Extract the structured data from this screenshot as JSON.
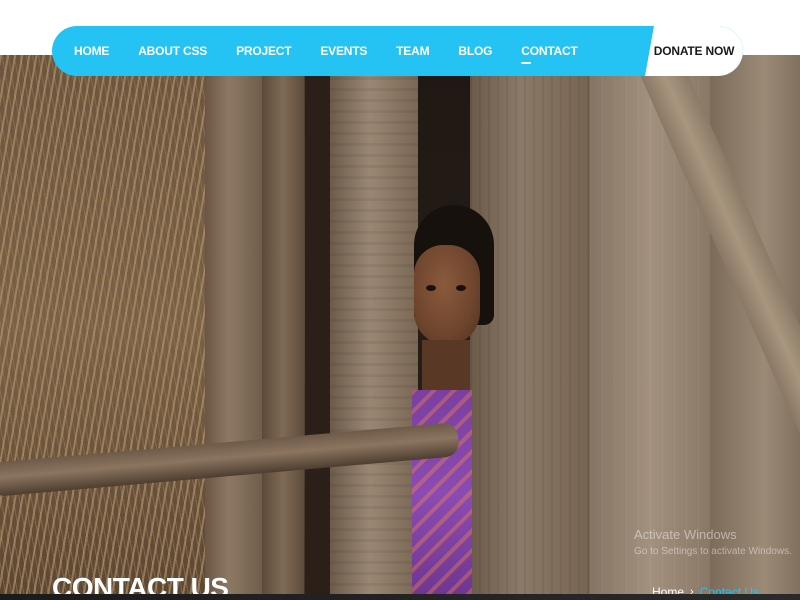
{
  "nav": {
    "items": [
      {
        "label": "HOME"
      },
      {
        "label": "ABOUT CSS"
      },
      {
        "label": "PROJECT"
      },
      {
        "label": "EVENTS"
      },
      {
        "label": "TEAM"
      },
      {
        "label": "BLOG"
      },
      {
        "label": "CONTACT",
        "active": true
      }
    ],
    "donate_label": "DONATE NOW",
    "accent_color": "#24c3f3"
  },
  "page": {
    "title": "CONTACT US"
  },
  "breadcrumb": {
    "home": "Home",
    "separator": "›",
    "current": "Contact Us"
  },
  "watermark": {
    "line1": "Activate Windows",
    "line2": "Go to Settings to activate Windows."
  }
}
